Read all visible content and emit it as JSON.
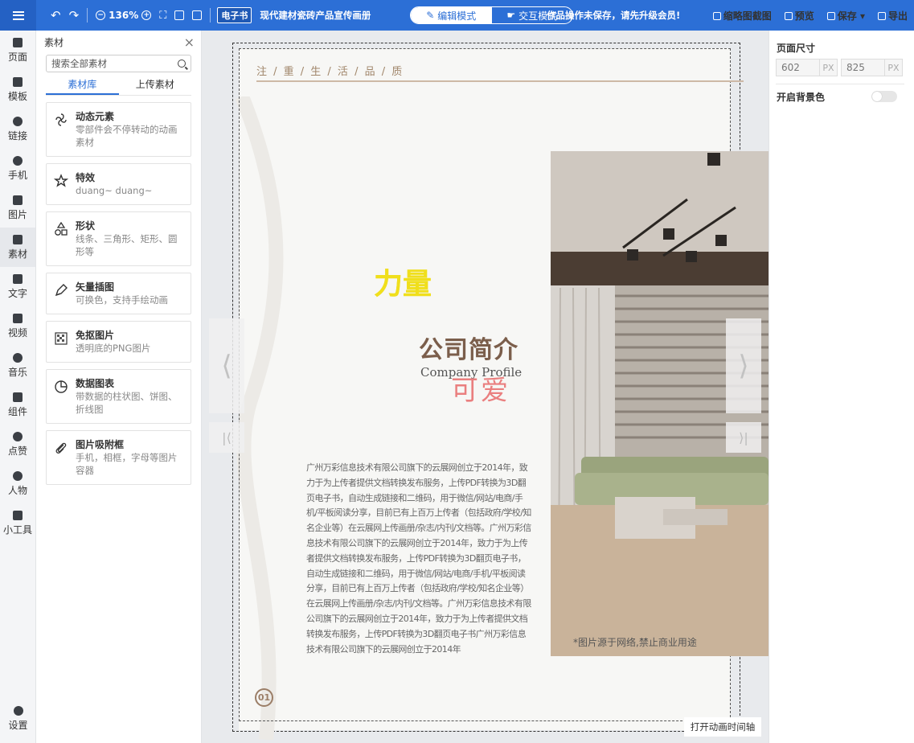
{
  "toolbar": {
    "zoom": "136%",
    "badge": "电子书",
    "doc_title": "现代建材瓷砖产品宣传画册",
    "mode_edit": "编辑模式",
    "mode_interact": "交互模式",
    "save_warning": "作品操作未保存，请先升级会员!",
    "actions": [
      "缩略图截图",
      "预览",
      "保存",
      "导出"
    ]
  },
  "leftnav": {
    "items": [
      "页面",
      "模板",
      "链接",
      "手机",
      "图片",
      "素材",
      "文字",
      "视频",
      "音乐",
      "组件",
      "点赞",
      "人物",
      "小工具"
    ],
    "settings": "设置"
  },
  "panel": {
    "title": "素材",
    "search_placeholder": "搜索全部素材",
    "tabs": [
      "素材库",
      "上传素材"
    ],
    "cards": [
      {
        "title": "动态元素",
        "desc": "零部件会不停转动的动画素材"
      },
      {
        "title": "特效",
        "desc": "duang~ duang~"
      },
      {
        "title": "形状",
        "desc": "线条、三角形、矩形、圆形等"
      },
      {
        "title": "矢量插图",
        "desc": "可换色，支持手绘动画"
      },
      {
        "title": "免抠图片",
        "desc": "透明底的PNG图片"
      },
      {
        "title": "数据图表",
        "desc": "带数据的柱状图、饼图、折线图"
      },
      {
        "title": "图片吸附框",
        "desc": "手机，相框，字母等图片容器"
      }
    ]
  },
  "page": {
    "tagline": "注 / 重 / 生 / 活 / 品 / 质",
    "deco_title": "力量",
    "company_title": "公司简介",
    "company_sub": "Company Profile",
    "cute_text": "可爱",
    "paragraph": "广州万彩信息技术有限公司旗下的云展网创立于2014年，致力于为上传者提供文档转换发布服务，上传PDF转换为3D翻页电子书，自动生成链接和二维码，用于微信/网站/电商/手机/平板阅读分享，目前已有上百万上传者（包括政府/学校/知名企业等）在云展网上传画册/杂志/内刊/文档等。广州万彩信息技术有限公司旗下的云展网创立于2014年，致力于为上传者提供文档转换发布服务，上传PDF转换为3D翻页电子书，自动生成链接和二维码，用于微信/网站/电商/手机/平板阅读分享，目前已有上百万上传者（包括政府/学校/知名企业等）在云展网上传画册/杂志/内刊/文档等。广州万彩信息技术有限公司旗下的云展网创立于2014年，致力于为上传者提供文档转换发布服务，上传PDF转换为3D翻页电子书广州万彩信息技术有限公司旗下的云展网创立于2014年",
    "photo_note": "*图片源于网络,禁止商业用途",
    "page_number": "01",
    "timeline_button": "打开动画时间轴"
  },
  "rightpanel": {
    "size_label": "页面尺寸",
    "width": "602",
    "height": "825",
    "unit": "PX",
    "bg_label": "开启背景色"
  }
}
